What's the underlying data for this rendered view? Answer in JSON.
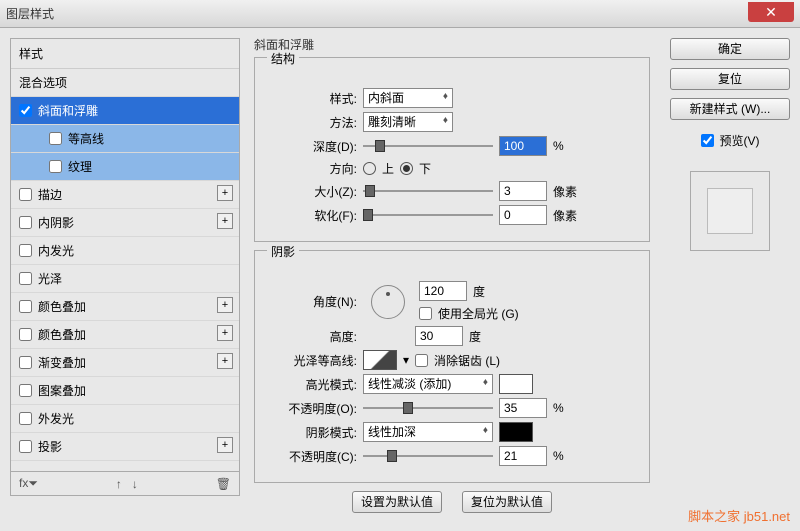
{
  "window": {
    "title": "图层样式"
  },
  "sidebar": {
    "header": "样式",
    "blend": "混合选项",
    "items": [
      {
        "label": "斜面和浮雕",
        "checked": true,
        "selected": true
      },
      {
        "label": "等高线",
        "sub": true
      },
      {
        "label": "纹理",
        "sub": true
      },
      {
        "label": "描边",
        "plus": true
      },
      {
        "label": "内阴影",
        "plus": true
      },
      {
        "label": "内发光"
      },
      {
        "label": "光泽"
      },
      {
        "label": "颜色叠加",
        "plus": true
      },
      {
        "label": "颜色叠加",
        "plus": true
      },
      {
        "label": "渐变叠加",
        "plus": true
      },
      {
        "label": "图案叠加"
      },
      {
        "label": "外发光"
      },
      {
        "label": "投影",
        "plus": true
      }
    ]
  },
  "content": {
    "title": "斜面和浮雕",
    "structure": {
      "legend": "结构",
      "style_label": "样式:",
      "style_value": "内斜面",
      "method_label": "方法:",
      "method_value": "雕刻清晰",
      "depth_label": "深度(D):",
      "depth_value": "100",
      "percent": "%",
      "direction_label": "方向:",
      "dir_up": "上",
      "dir_down": "下",
      "size_label": "大小(Z):",
      "size_value": "3",
      "px": "像素",
      "soften_label": "软化(F):",
      "soften_value": "0"
    },
    "shadow": {
      "legend": "阴影",
      "angle_label": "角度(N):",
      "angle_value": "120",
      "deg": "度",
      "global_label": "使用全局光 (G)",
      "altitude_label": "高度:",
      "altitude_value": "30",
      "gloss_label": "光泽等高线:",
      "antialias_label": "消除锯齿 (L)",
      "highlight_mode_label": "高光模式:",
      "highlight_mode_value": "线性减淡 (添加)",
      "highlight_opacity_label": "不透明度(O):",
      "highlight_opacity_value": "35",
      "shadow_mode_label": "阴影模式:",
      "shadow_mode_value": "线性加深",
      "shadow_opacity_label": "不透明度(C):",
      "shadow_opacity_value": "21"
    },
    "set_default": "设置为默认值",
    "reset_default": "复位为默认值"
  },
  "buttons": {
    "ok": "确定",
    "reset": "复位",
    "new_style": "新建样式 (W)...",
    "preview": "预览(V)"
  },
  "watermark": "脚本之家  jb51.net"
}
